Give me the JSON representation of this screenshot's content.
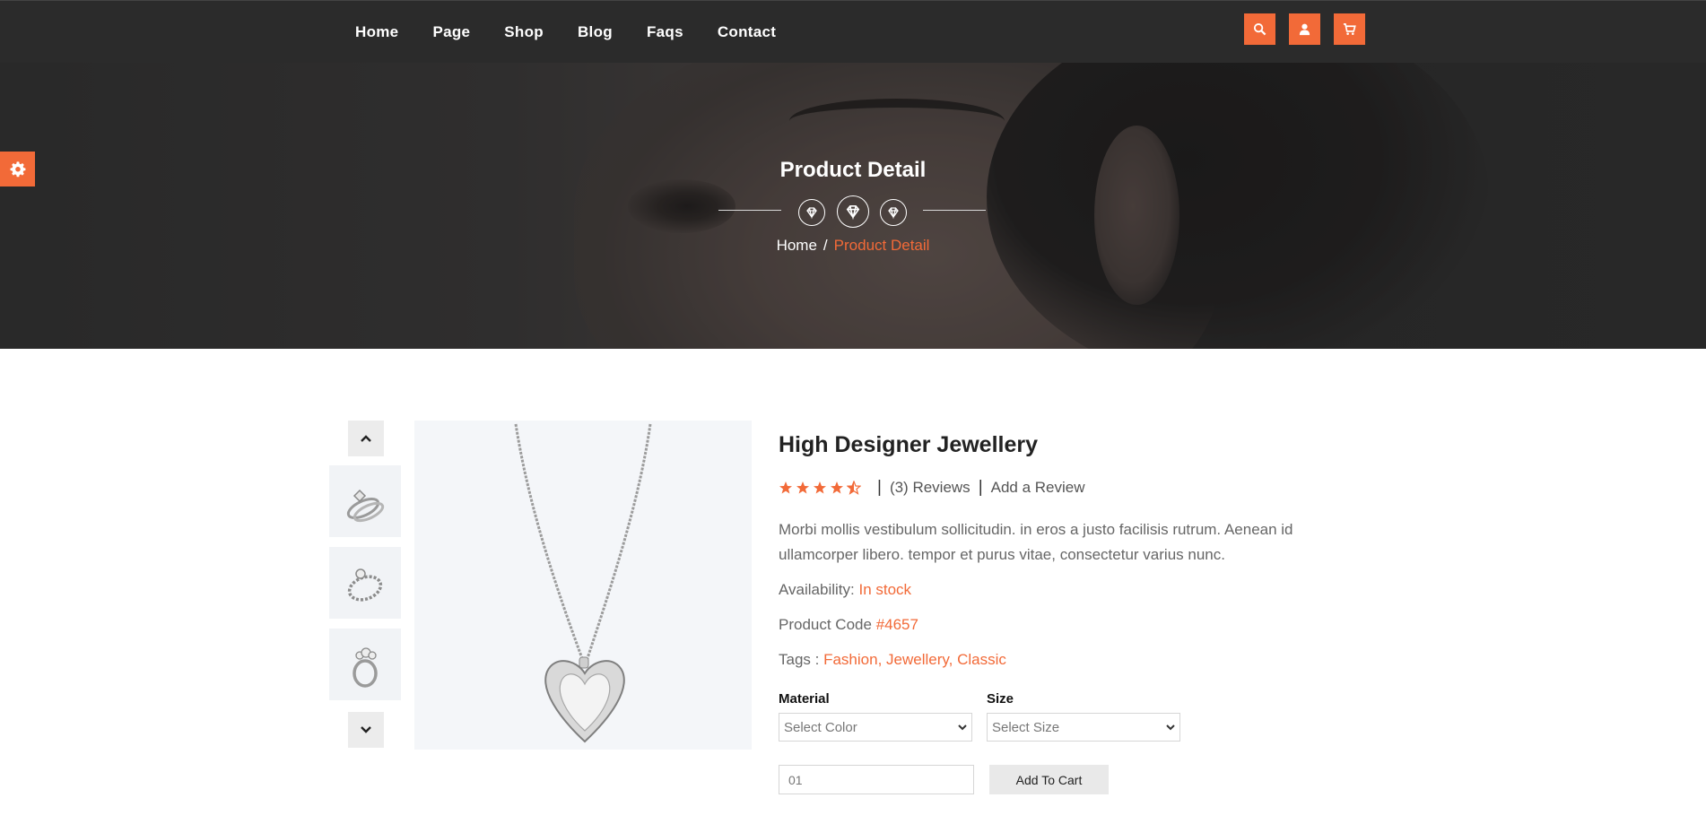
{
  "nav": {
    "links": [
      "Home",
      "Page",
      "Shop",
      "Blog",
      "Faqs",
      "Contact"
    ],
    "icons": [
      "search-icon",
      "user-icon",
      "cart-icon"
    ]
  },
  "hero": {
    "title": "Product Detail",
    "breadcrumb": {
      "home": "Home",
      "separator": "/",
      "current": "Product Detail"
    }
  },
  "settings": {
    "icon": "gear-icon"
  },
  "gallery": {
    "thumbnails": [
      "ring-thumbnail-1",
      "ring-thumbnail-2",
      "ring-thumbnail-3"
    ],
    "main_image": "heart-pendant-necklace"
  },
  "product": {
    "title": "High Designer Jewellery",
    "rating": 4.5,
    "reviews_text": "(3) Reviews",
    "add_review": "Add a Review",
    "description": "Morbi mollis vestibulum sollicitudin. in eros a justo facilisis rutrum. Aenean id ullamcorper libero. tempor et purus vitae, consectetur varius nunc.",
    "availability_label": "Availability:",
    "availability_value": "In stock",
    "code_label": "Product Code",
    "code_value": "#4657",
    "tags_label": "Tags :",
    "tags": [
      "Fashion",
      "Jewellery",
      "Classic"
    ],
    "material_label": "Material",
    "size_label": "Size",
    "material_placeholder": "Select Color",
    "size_placeholder": "Select Size",
    "quantity": "01",
    "add_to_cart": "Add To Cart"
  },
  "colors": {
    "accent": "#f26a38",
    "nav_bg": "#2b2b2b"
  }
}
